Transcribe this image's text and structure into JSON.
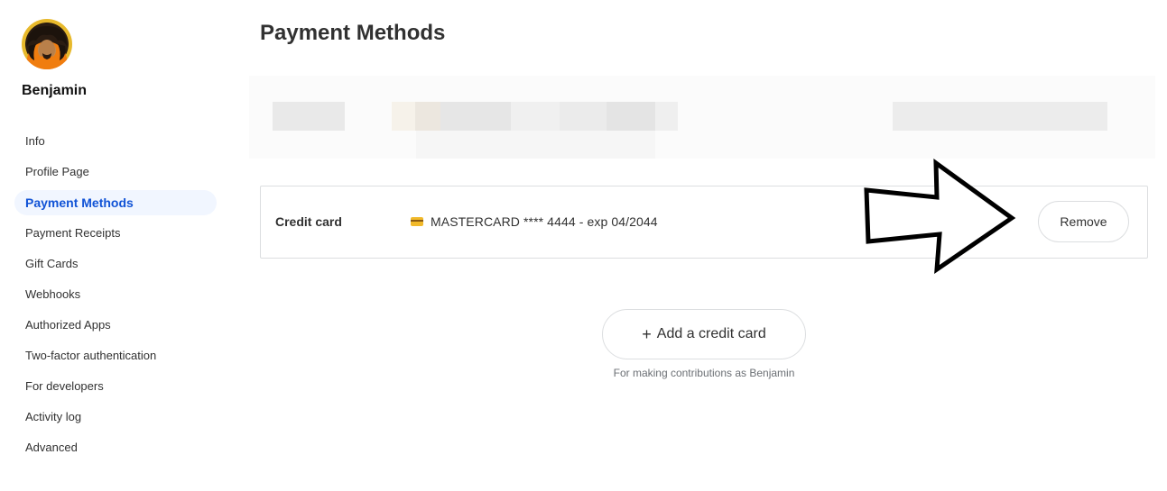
{
  "user": {
    "name": "Benjamin"
  },
  "sidebar": {
    "items": [
      {
        "label": "Info"
      },
      {
        "label": "Profile Page"
      },
      {
        "label": "Payment Methods",
        "active": true
      },
      {
        "label": "Payment Receipts"
      },
      {
        "label": "Gift Cards"
      },
      {
        "label": "Webhooks"
      },
      {
        "label": "Authorized Apps"
      },
      {
        "label": "Two-factor authentication"
      },
      {
        "label": "For developers"
      },
      {
        "label": "Activity log"
      },
      {
        "label": "Advanced"
      }
    ]
  },
  "main": {
    "title": "Payment Methods",
    "card": {
      "label": "Credit card",
      "icon": "credit-card-icon",
      "details": "MASTERCARD **** 4444 - exp 04/2044",
      "remove_label": "Remove"
    },
    "add_card": {
      "icon": "plus-icon",
      "label": "Add a credit card",
      "note": "For making contributions as Benjamin"
    }
  },
  "colors": {
    "accent": "#1153d6",
    "active_bg": "#f1f6ff",
    "border": "#dcdee0",
    "text": "#313131"
  }
}
